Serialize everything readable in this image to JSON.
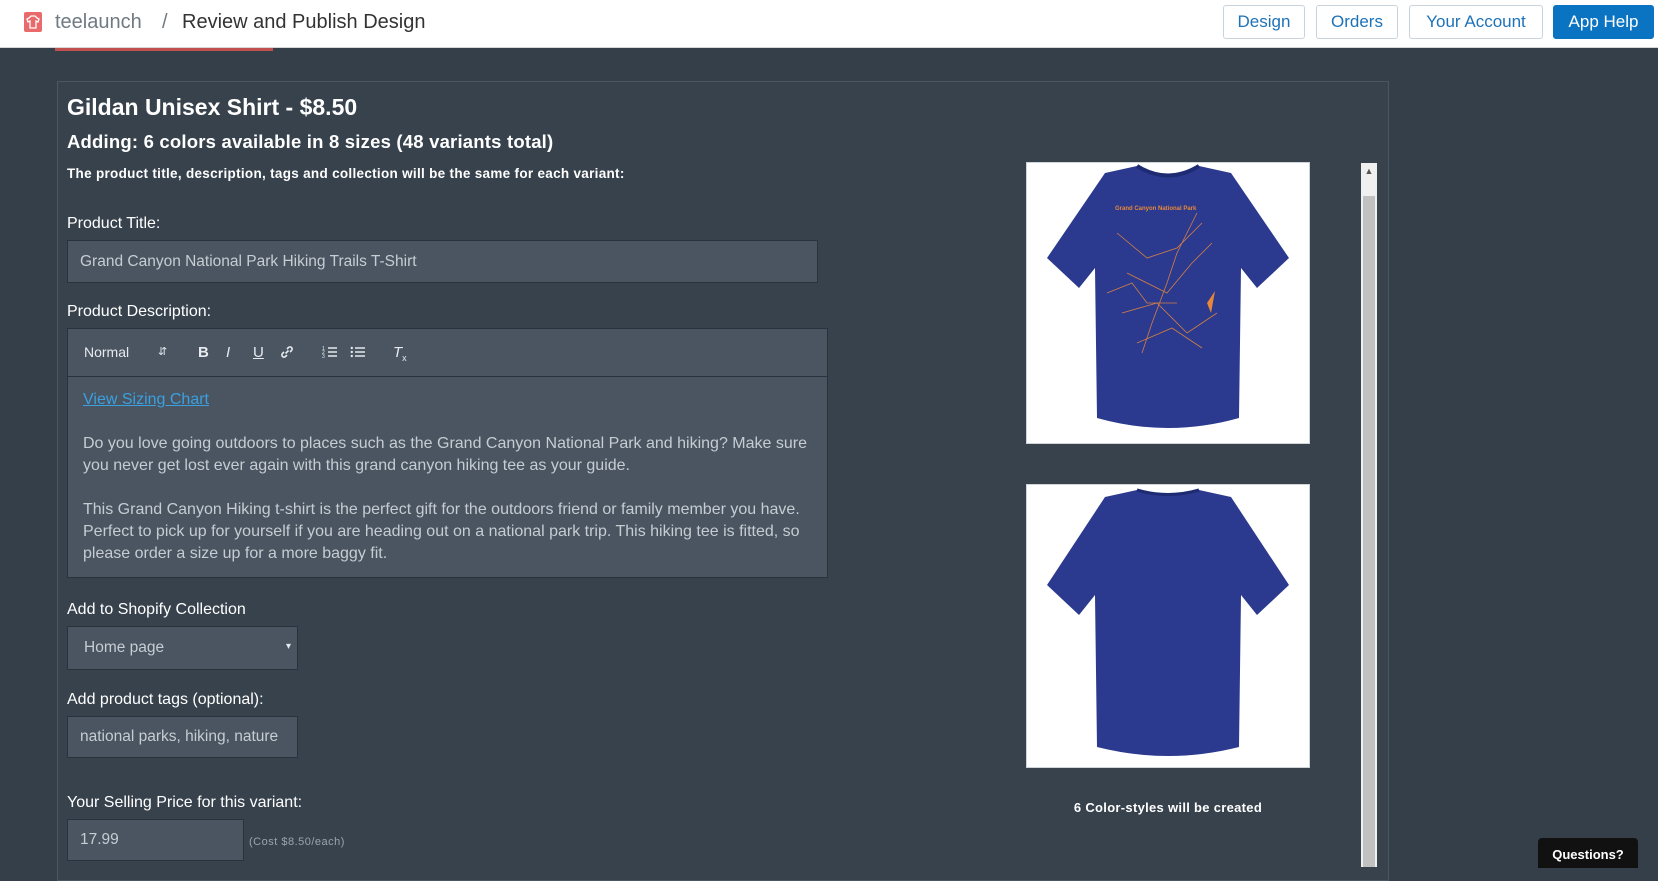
{
  "header": {
    "brand": "teelaunch",
    "separator": "/",
    "page_title": "Review and Publish Design",
    "nav": {
      "design": "Design",
      "orders": "Orders",
      "account": "Your Account",
      "help": "App Help"
    }
  },
  "product": {
    "heading": "Gildan Unisex Shirt - $8.50",
    "subheading": "Adding: 6 colors available in 8 sizes (48 variants total)",
    "note": "The product title, description, tags and collection will be the same for each variant:"
  },
  "form": {
    "title_label": "Product Title:",
    "title_value": "Grand Canyon National Park Hiking Trails T-Shirt",
    "description_label": "Product Description:",
    "editor": {
      "format": "Normal",
      "bold": "B",
      "italic": "I",
      "underline": "U",
      "clear": "Tx"
    },
    "description": {
      "link": "View Sizing Chart",
      "p1": "Do you love going outdoors to places such as the Grand Canyon National Park and hiking? Make sure you never get lost ever again with this grand canyon hiking tee as your guide.",
      "p2": "This Grand Canyon Hiking t-shirt is the perfect gift for the outdoors friend or family member you have. Perfect to pick up for yourself if you are heading out on a national park trip. This hiking tee is fitted, so please order a size up for a more baggy fit."
    },
    "collection_label": "Add to Shopify Collection",
    "collection_value": "Home page",
    "tags_label": "Add product tags (optional):",
    "tags_value": "national parks, hiking, nature",
    "price_label": "Your Selling Price for this variant:",
    "price_value": "17.99",
    "cost_note": "(Cost $8.50/each)"
  },
  "preview": {
    "front_print_title": "Grand Canyon National Park",
    "caption": "6 Color-styles will be created",
    "shirt_color": "#2b3a8f",
    "print_color": "#e8873a"
  },
  "chat": {
    "label": "Questions?"
  }
}
